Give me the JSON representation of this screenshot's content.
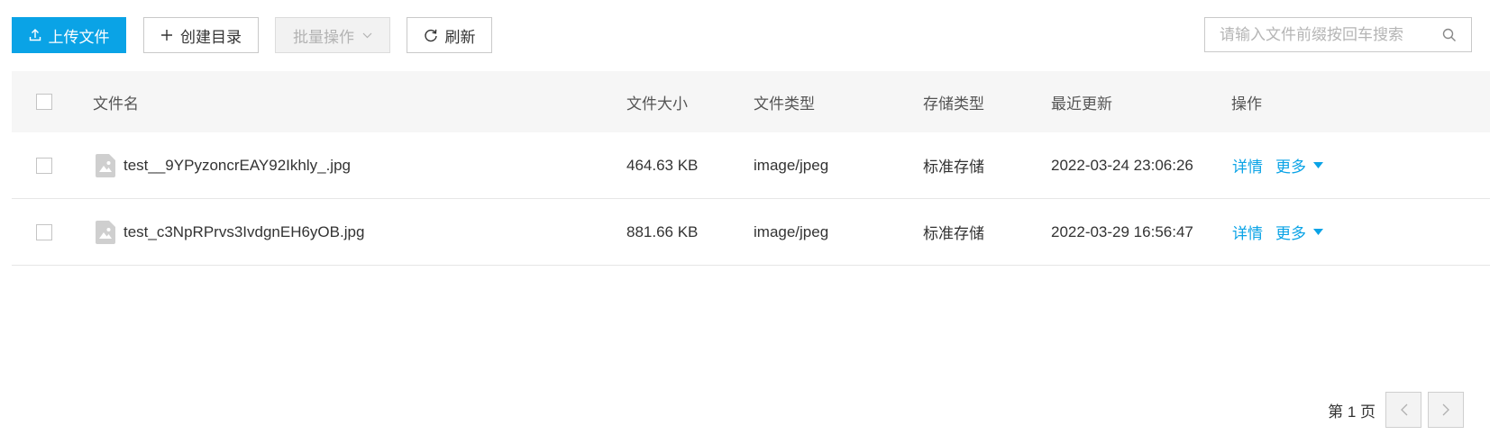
{
  "toolbar": {
    "upload_label": "上传文件",
    "mkdir_label": "创建目录",
    "batch_label": "批量操作",
    "refresh_label": "刷新"
  },
  "search": {
    "placeholder": "请输入文件前缀按回车搜索"
  },
  "table": {
    "headers": {
      "name": "文件名",
      "size": "文件大小",
      "type": "文件类型",
      "storage": "存储类型",
      "updated": "最近更新",
      "actions": "操作"
    },
    "rows": [
      {
        "name": "test__9YPyzoncrEAY92Ikhly_.jpg",
        "size": "464.63 KB",
        "type": "image/jpeg",
        "storage": "标准存储",
        "updated": "2022-03-24 23:06:26",
        "detail": "详情",
        "more": "更多"
      },
      {
        "name": "test_c3NpRPrvs3IvdgnEH6yOB.jpg",
        "size": "881.66 KB",
        "type": "image/jpeg",
        "storage": "标准存储",
        "updated": "2022-03-29 16:56:47",
        "detail": "详情",
        "more": "更多"
      }
    ]
  },
  "pagination": {
    "label": "第 1 页"
  },
  "icons": {
    "upload": "upload-icon",
    "mkdir": "plus-icon",
    "batch": "chevron-down-icon",
    "refresh": "refresh-icon",
    "search": "search-icon",
    "file": "image-file-icon",
    "more": "caret-down-icon",
    "prev": "chevron-left-icon",
    "next": "chevron-right-icon"
  },
  "colors": {
    "accent": "#0aa3e6",
    "header_bg": "#f6f6f6"
  }
}
